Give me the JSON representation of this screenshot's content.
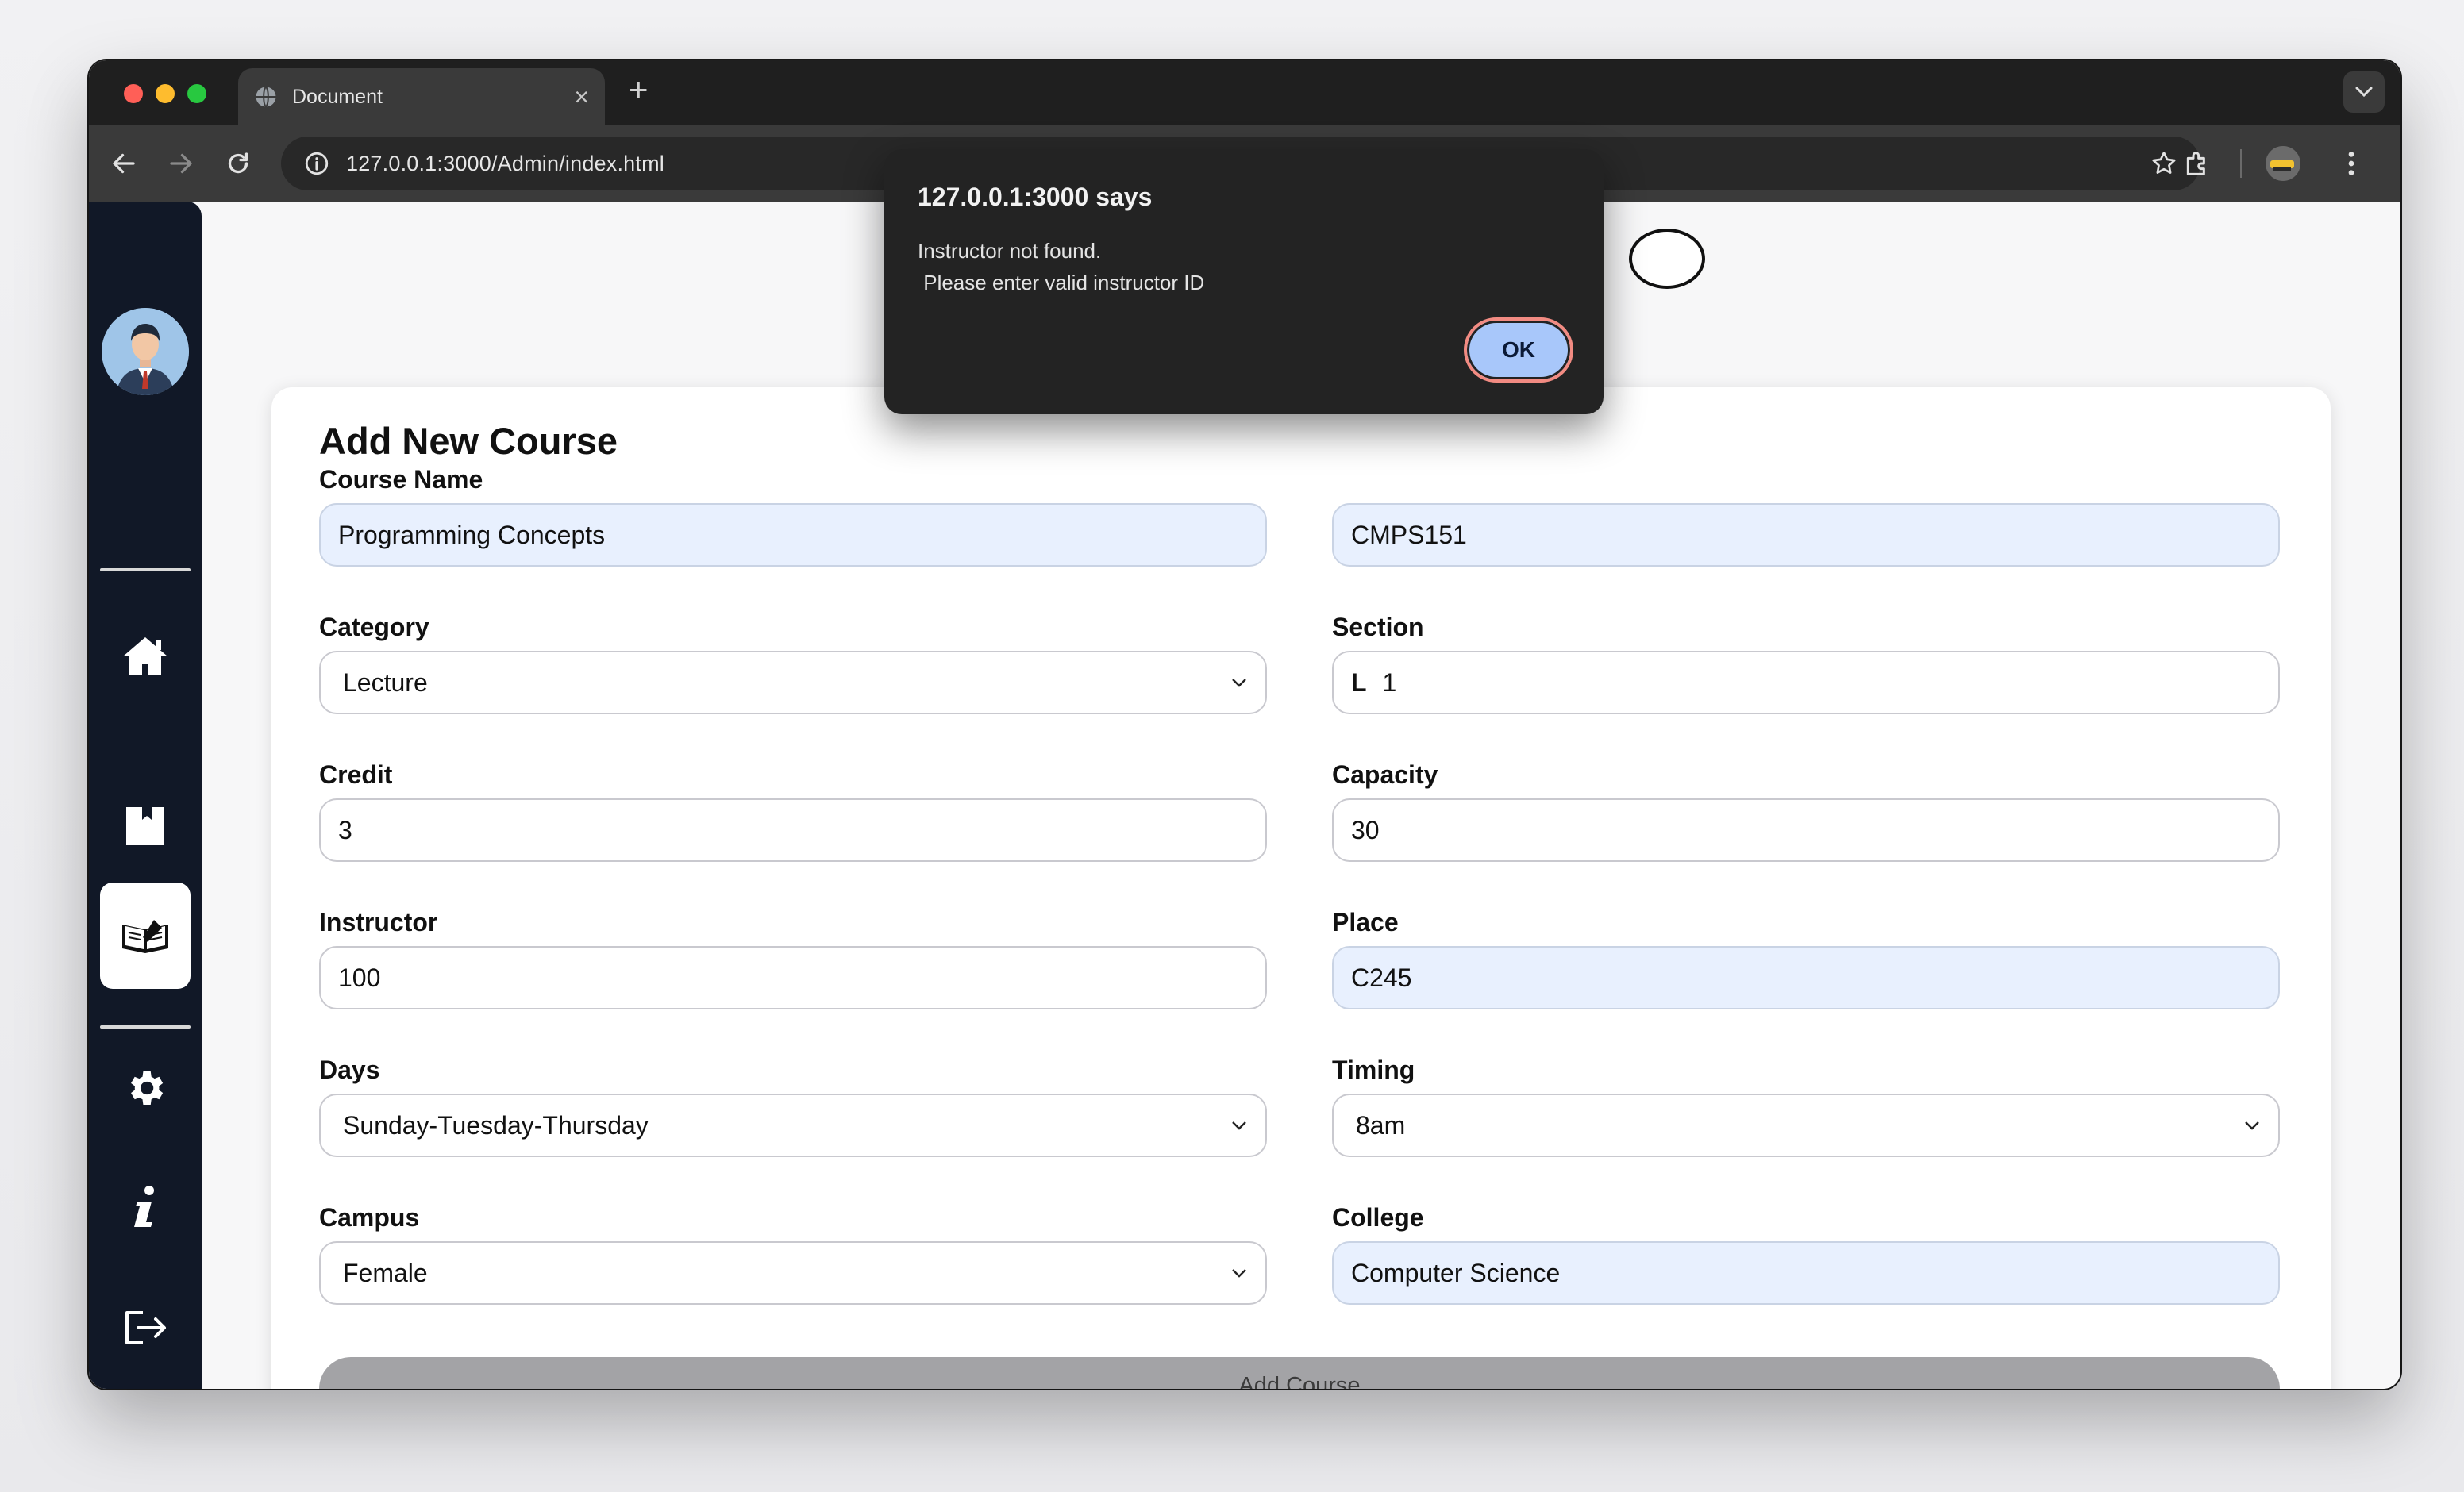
{
  "browser": {
    "tab_title": "Document",
    "url": "127.0.0.1:3000/Admin/index.html",
    "new_tab_symbol": "+",
    "close_symbol": "×"
  },
  "sidebar": {
    "items": [
      {
        "icon": "home-icon"
      },
      {
        "icon": "bookmark-icon"
      },
      {
        "icon": "book-icon",
        "active": true
      },
      {
        "icon": "gear-icon"
      },
      {
        "icon": "info-icon"
      },
      {
        "icon": "logout-icon"
      }
    ]
  },
  "form": {
    "title": "Add New Course",
    "fields": {
      "course_name": {
        "label": "Course Name",
        "value": "Programming Concepts"
      },
      "course_code": {
        "label": "",
        "value": "CMPS151"
      },
      "category": {
        "label": "Category",
        "value": "Lecture"
      },
      "section": {
        "label": "Section",
        "prefix": "L",
        "value": "1"
      },
      "credit": {
        "label": "Credit",
        "value": "3"
      },
      "capacity": {
        "label": "Capacity",
        "value": "30"
      },
      "instructor": {
        "label": "Instructor",
        "value": "100"
      },
      "place": {
        "label": "Place",
        "value": "C245"
      },
      "days": {
        "label": "Days",
        "value": "Sunday-Tuesday-Thursday"
      },
      "timing": {
        "label": "Timing",
        "value": "8am"
      },
      "campus": {
        "label": "Campus",
        "value": "Female"
      },
      "college": {
        "label": "College",
        "value": "Computer Science"
      }
    },
    "submit_label": "Add Course"
  },
  "alert": {
    "title": "127.0.0.1:3000 says",
    "message": "Instructor not found.\n Please enter valid instructor ID",
    "ok_label": "OK"
  },
  "colors": {
    "sidebar_bg": "#111827",
    "autofill_bg": "#e8f0fe",
    "ok_button": "#a8c7fa",
    "submit_button": "#a3a3a6"
  }
}
